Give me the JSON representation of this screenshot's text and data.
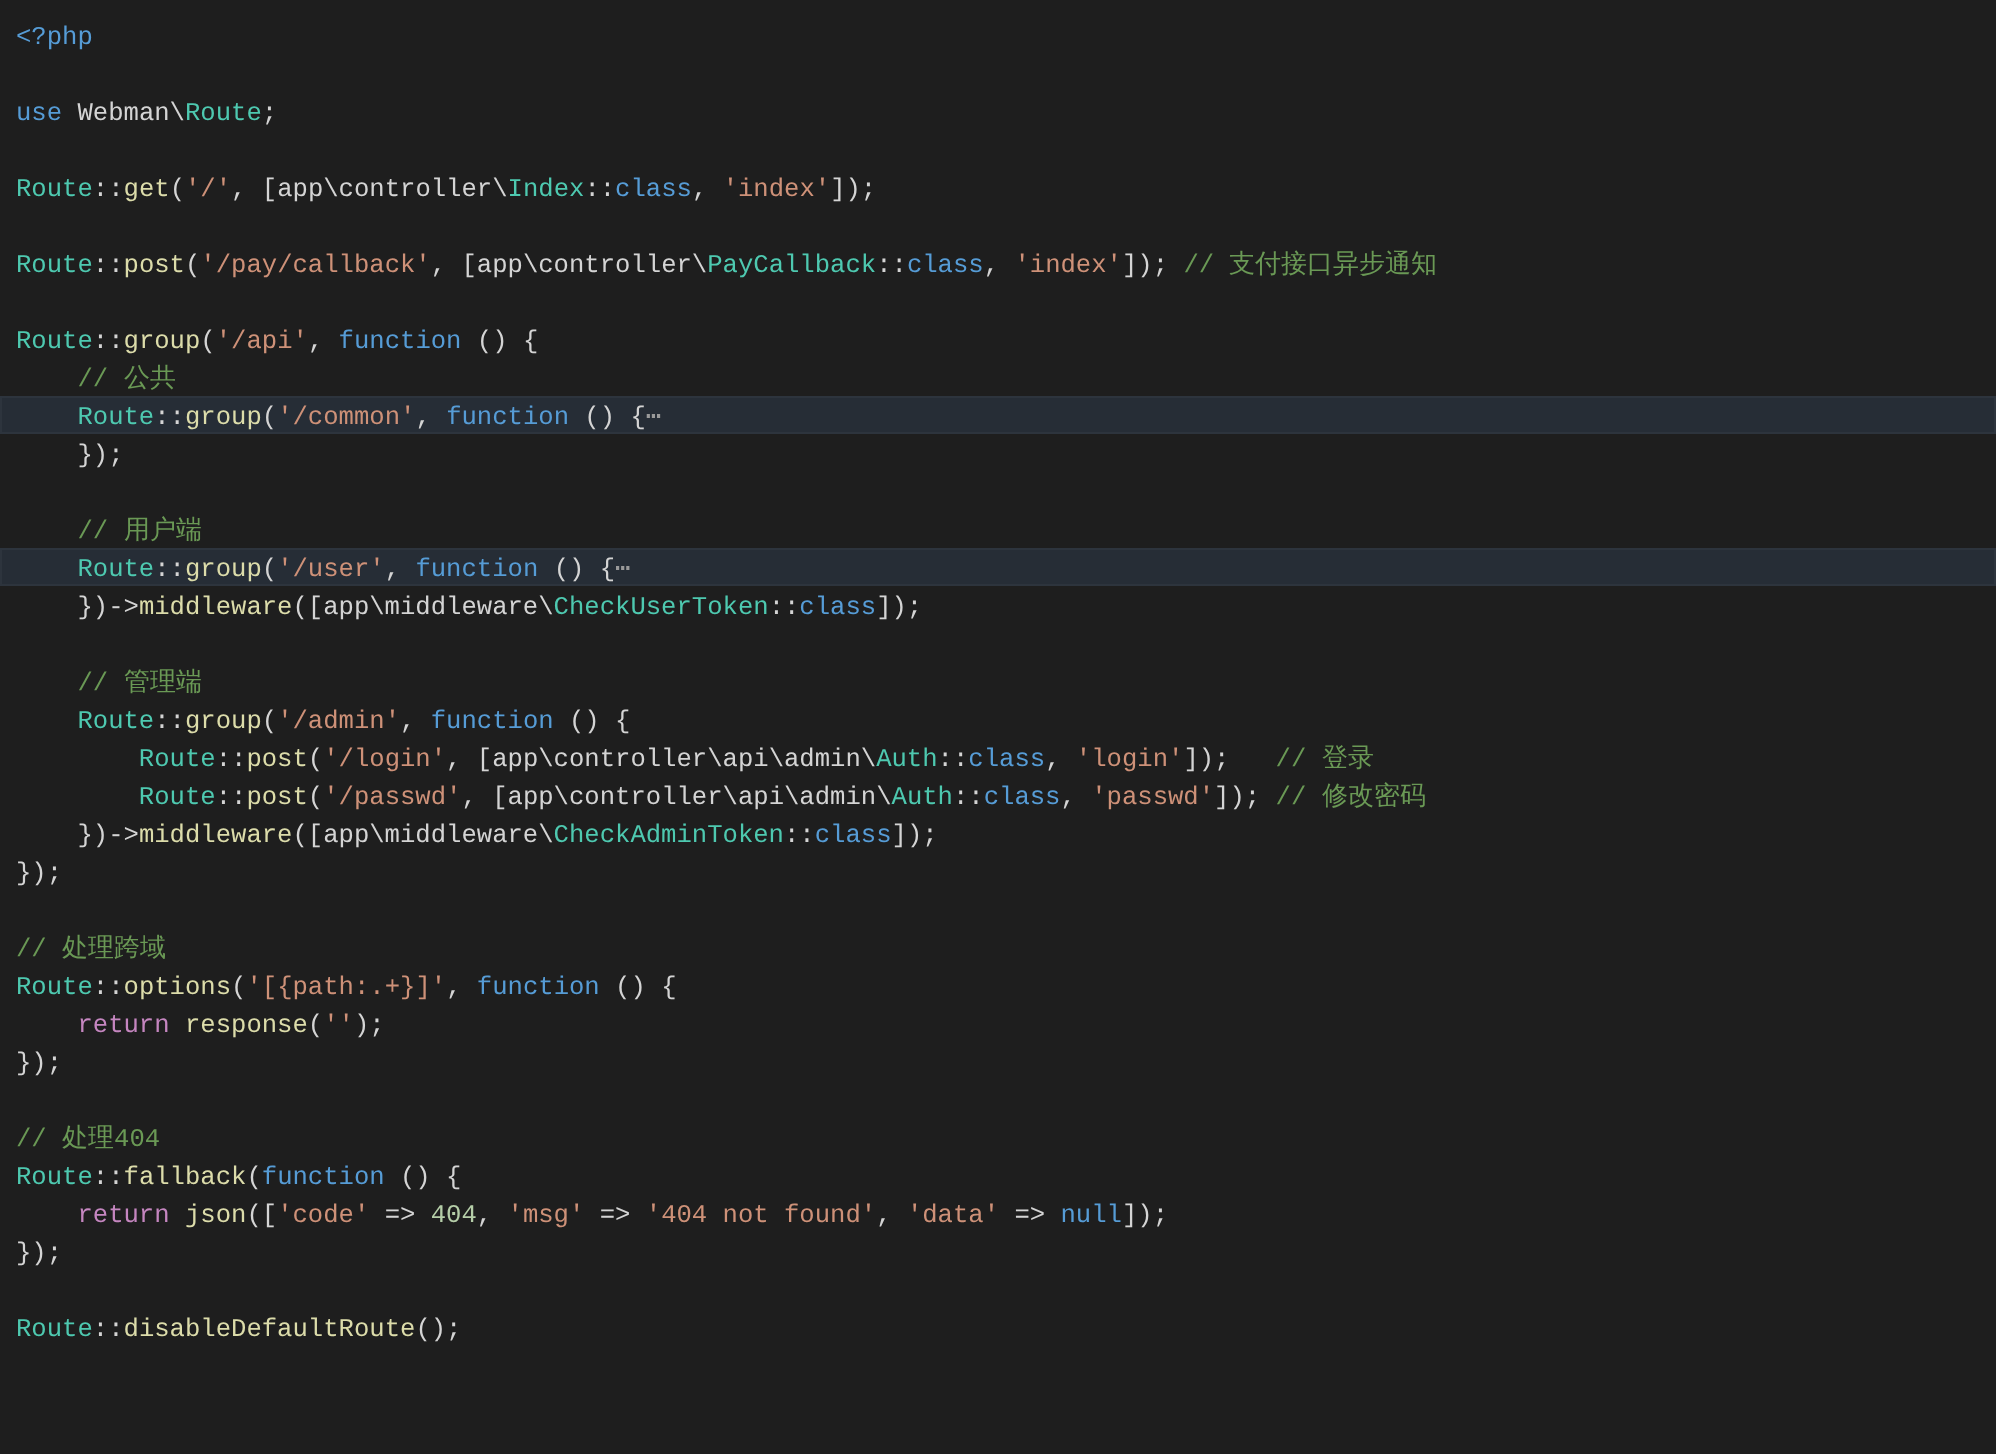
{
  "editor": {
    "lines": [
      {
        "kind": "code",
        "highlighted": false,
        "tokens": [
          {
            "kind": "tag",
            "text": "<?php"
          }
        ]
      },
      {
        "kind": "blank"
      },
      {
        "kind": "code",
        "highlighted": false,
        "tokens": [
          {
            "kind": "keyword",
            "text": "use"
          },
          {
            "kind": "plain",
            "text": " Webman\\"
          },
          {
            "kind": "type",
            "text": "Route"
          },
          {
            "kind": "plain",
            "text": ";"
          }
        ]
      },
      {
        "kind": "blank"
      },
      {
        "kind": "code",
        "highlighted": false,
        "tokens": [
          {
            "kind": "type",
            "text": "Route"
          },
          {
            "kind": "plain",
            "text": "::"
          },
          {
            "kind": "func",
            "text": "get"
          },
          {
            "kind": "plain",
            "text": "("
          },
          {
            "kind": "string",
            "text": "'/'"
          },
          {
            "kind": "plain",
            "text": ", [app\\controller\\"
          },
          {
            "kind": "type",
            "text": "Index"
          },
          {
            "kind": "plain",
            "text": "::"
          },
          {
            "kind": "keyword",
            "text": "class"
          },
          {
            "kind": "plain",
            "text": ", "
          },
          {
            "kind": "string",
            "text": "'index'"
          },
          {
            "kind": "plain",
            "text": "]);"
          }
        ]
      },
      {
        "kind": "blank"
      },
      {
        "kind": "code",
        "highlighted": false,
        "tokens": [
          {
            "kind": "type",
            "text": "Route"
          },
          {
            "kind": "plain",
            "text": "::"
          },
          {
            "kind": "func",
            "text": "post"
          },
          {
            "kind": "plain",
            "text": "("
          },
          {
            "kind": "string",
            "text": "'/pay/callback'"
          },
          {
            "kind": "plain",
            "text": ", [app\\controller\\"
          },
          {
            "kind": "type",
            "text": "PayCallback"
          },
          {
            "kind": "plain",
            "text": "::"
          },
          {
            "kind": "keyword",
            "text": "class"
          },
          {
            "kind": "plain",
            "text": ", "
          },
          {
            "kind": "string",
            "text": "'index'"
          },
          {
            "kind": "plain",
            "text": "]); "
          },
          {
            "kind": "comment",
            "text": "// 支付接口异步通知"
          }
        ]
      },
      {
        "kind": "blank"
      },
      {
        "kind": "code",
        "highlighted": false,
        "tokens": [
          {
            "kind": "type",
            "text": "Route"
          },
          {
            "kind": "plain",
            "text": "::"
          },
          {
            "kind": "func",
            "text": "group"
          },
          {
            "kind": "plain",
            "text": "("
          },
          {
            "kind": "string",
            "text": "'/api'"
          },
          {
            "kind": "plain",
            "text": ", "
          },
          {
            "kind": "keyword",
            "text": "function"
          },
          {
            "kind": "plain",
            "text": " () {"
          }
        ]
      },
      {
        "kind": "code",
        "highlighted": false,
        "tokens": [
          {
            "kind": "comment",
            "text": "    // 公共"
          }
        ]
      },
      {
        "kind": "code",
        "highlighted": true,
        "tokens": [
          {
            "kind": "type",
            "text": "    Route"
          },
          {
            "kind": "plain",
            "text": "::"
          },
          {
            "kind": "func",
            "text": "group"
          },
          {
            "kind": "plain",
            "text": "("
          },
          {
            "kind": "string",
            "text": "'/common'"
          },
          {
            "kind": "plain",
            "text": ", "
          },
          {
            "kind": "keyword",
            "text": "function"
          },
          {
            "kind": "plain",
            "text": " () {"
          },
          {
            "kind": "fold",
            "text": "⋯"
          }
        ]
      },
      {
        "kind": "code",
        "highlighted": false,
        "tokens": [
          {
            "kind": "plain",
            "text": "    });"
          }
        ]
      },
      {
        "kind": "blank"
      },
      {
        "kind": "code",
        "highlighted": false,
        "tokens": [
          {
            "kind": "comment",
            "text": "    // 用户端"
          }
        ]
      },
      {
        "kind": "code",
        "highlighted": true,
        "tokens": [
          {
            "kind": "type",
            "text": "    Route"
          },
          {
            "kind": "plain",
            "text": "::"
          },
          {
            "kind": "func",
            "text": "group"
          },
          {
            "kind": "plain",
            "text": "("
          },
          {
            "kind": "string",
            "text": "'/user'"
          },
          {
            "kind": "plain",
            "text": ", "
          },
          {
            "kind": "keyword",
            "text": "function"
          },
          {
            "kind": "plain",
            "text": " () {"
          },
          {
            "kind": "fold",
            "text": "⋯"
          }
        ]
      },
      {
        "kind": "code",
        "highlighted": false,
        "tokens": [
          {
            "kind": "plain",
            "text": "    })->"
          },
          {
            "kind": "func",
            "text": "middleware"
          },
          {
            "kind": "plain",
            "text": "([app\\middleware\\"
          },
          {
            "kind": "type",
            "text": "CheckUserToken"
          },
          {
            "kind": "plain",
            "text": "::"
          },
          {
            "kind": "keyword",
            "text": "class"
          },
          {
            "kind": "plain",
            "text": "]);"
          }
        ]
      },
      {
        "kind": "blank"
      },
      {
        "kind": "code",
        "highlighted": false,
        "tokens": [
          {
            "kind": "comment",
            "text": "    // 管理端"
          }
        ]
      },
      {
        "kind": "code",
        "highlighted": false,
        "tokens": [
          {
            "kind": "type",
            "text": "    Route"
          },
          {
            "kind": "plain",
            "text": "::"
          },
          {
            "kind": "func",
            "text": "group"
          },
          {
            "kind": "plain",
            "text": "("
          },
          {
            "kind": "string",
            "text": "'/admin'"
          },
          {
            "kind": "plain",
            "text": ", "
          },
          {
            "kind": "keyword",
            "text": "function"
          },
          {
            "kind": "plain",
            "text": " () {"
          }
        ]
      },
      {
        "kind": "code",
        "highlighted": false,
        "tokens": [
          {
            "kind": "type",
            "text": "        Route"
          },
          {
            "kind": "plain",
            "text": "::"
          },
          {
            "kind": "func",
            "text": "post"
          },
          {
            "kind": "plain",
            "text": "("
          },
          {
            "kind": "string",
            "text": "'/login'"
          },
          {
            "kind": "plain",
            "text": ", [app\\controller\\api\\admin\\"
          },
          {
            "kind": "type",
            "text": "Auth"
          },
          {
            "kind": "plain",
            "text": "::"
          },
          {
            "kind": "keyword",
            "text": "class"
          },
          {
            "kind": "plain",
            "text": ", "
          },
          {
            "kind": "string",
            "text": "'login'"
          },
          {
            "kind": "plain",
            "text": "]);   "
          },
          {
            "kind": "comment",
            "text": "// 登录"
          }
        ]
      },
      {
        "kind": "code",
        "highlighted": false,
        "tokens": [
          {
            "kind": "type",
            "text": "        Route"
          },
          {
            "kind": "plain",
            "text": "::"
          },
          {
            "kind": "func",
            "text": "post"
          },
          {
            "kind": "plain",
            "text": "("
          },
          {
            "kind": "string",
            "text": "'/passwd'"
          },
          {
            "kind": "plain",
            "text": ", [app\\controller\\api\\admin\\"
          },
          {
            "kind": "type",
            "text": "Auth"
          },
          {
            "kind": "plain",
            "text": "::"
          },
          {
            "kind": "keyword",
            "text": "class"
          },
          {
            "kind": "plain",
            "text": ", "
          },
          {
            "kind": "string",
            "text": "'passwd'"
          },
          {
            "kind": "plain",
            "text": "]); "
          },
          {
            "kind": "comment",
            "text": "// 修改密码"
          }
        ]
      },
      {
        "kind": "code",
        "highlighted": false,
        "tokens": [
          {
            "kind": "plain",
            "text": "    })->"
          },
          {
            "kind": "func",
            "text": "middleware"
          },
          {
            "kind": "plain",
            "text": "([app\\middleware\\"
          },
          {
            "kind": "type",
            "text": "CheckAdminToken"
          },
          {
            "kind": "plain",
            "text": "::"
          },
          {
            "kind": "keyword",
            "text": "class"
          },
          {
            "kind": "plain",
            "text": "]);"
          }
        ]
      },
      {
        "kind": "code",
        "highlighted": false,
        "tokens": [
          {
            "kind": "plain",
            "text": "});"
          }
        ]
      },
      {
        "kind": "blank"
      },
      {
        "kind": "code",
        "highlighted": false,
        "tokens": [
          {
            "kind": "comment",
            "text": "// 处理跨域"
          }
        ]
      },
      {
        "kind": "code",
        "highlighted": false,
        "tokens": [
          {
            "kind": "type",
            "text": "Route"
          },
          {
            "kind": "plain",
            "text": "::"
          },
          {
            "kind": "func",
            "text": "options"
          },
          {
            "kind": "plain",
            "text": "("
          },
          {
            "kind": "string",
            "text": "'[{path:.+}]'"
          },
          {
            "kind": "plain",
            "text": ", "
          },
          {
            "kind": "keyword",
            "text": "function"
          },
          {
            "kind": "plain",
            "text": " () {"
          }
        ]
      },
      {
        "kind": "code",
        "highlighted": false,
        "tokens": [
          {
            "kind": "control",
            "text": "    return "
          },
          {
            "kind": "func",
            "text": "response"
          },
          {
            "kind": "plain",
            "text": "("
          },
          {
            "kind": "string",
            "text": "''"
          },
          {
            "kind": "plain",
            "text": ");"
          }
        ]
      },
      {
        "kind": "code",
        "highlighted": false,
        "tokens": [
          {
            "kind": "plain",
            "text": "});"
          }
        ]
      },
      {
        "kind": "blank"
      },
      {
        "kind": "code",
        "highlighted": false,
        "tokens": [
          {
            "kind": "comment",
            "text": "// 处理404"
          }
        ]
      },
      {
        "kind": "code",
        "highlighted": false,
        "tokens": [
          {
            "kind": "type",
            "text": "Route"
          },
          {
            "kind": "plain",
            "text": "::"
          },
          {
            "kind": "func",
            "text": "fallback"
          },
          {
            "kind": "plain",
            "text": "("
          },
          {
            "kind": "keyword",
            "text": "function"
          },
          {
            "kind": "plain",
            "text": " () {"
          }
        ]
      },
      {
        "kind": "code",
        "highlighted": false,
        "tokens": [
          {
            "kind": "control",
            "text": "    return "
          },
          {
            "kind": "func",
            "text": "json"
          },
          {
            "kind": "plain",
            "text": "(["
          },
          {
            "kind": "string",
            "text": "'code'"
          },
          {
            "kind": "plain",
            "text": " => "
          },
          {
            "kind": "number",
            "text": "404"
          },
          {
            "kind": "plain",
            "text": ", "
          },
          {
            "kind": "string",
            "text": "'msg'"
          },
          {
            "kind": "plain",
            "text": " => "
          },
          {
            "kind": "string",
            "text": "'404 not found'"
          },
          {
            "kind": "plain",
            "text": ", "
          },
          {
            "kind": "string",
            "text": "'data'"
          },
          {
            "kind": "plain",
            "text": " => "
          },
          {
            "kind": "keyword",
            "text": "null"
          },
          {
            "kind": "plain",
            "text": "]);"
          }
        ]
      },
      {
        "kind": "code",
        "highlighted": false,
        "tokens": [
          {
            "kind": "plain",
            "text": "});"
          }
        ]
      },
      {
        "kind": "blank"
      },
      {
        "kind": "code",
        "highlighted": false,
        "tokens": [
          {
            "kind": "type",
            "text": "Route"
          },
          {
            "kind": "plain",
            "text": "::"
          },
          {
            "kind": "func",
            "text": "disableDefaultRoute"
          },
          {
            "kind": "plain",
            "text": "();"
          }
        ]
      }
    ]
  }
}
